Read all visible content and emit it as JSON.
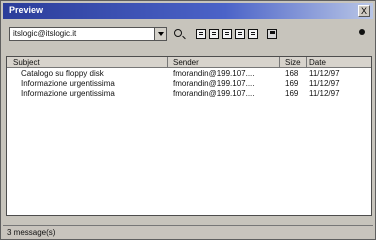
{
  "window": {
    "title": "Preview",
    "close_label": "X"
  },
  "toolbar": {
    "account": "itslogic@itslogic.it"
  },
  "list": {
    "columns": [
      "Subject",
      "Sender",
      "Size",
      "Date"
    ],
    "rows": [
      {
        "subject": "Catalogo su floppy disk",
        "sender": "fmorandin@199.107....",
        "size": "168",
        "date": "11/12/97"
      },
      {
        "subject": "Informazione urgentissima",
        "sender": "fmorandin@199.107....",
        "size": "169",
        "date": "11/12/97"
      },
      {
        "subject": "Informazione urgentissima",
        "sender": "fmorandin@199.107....",
        "size": "169",
        "date": "11/12/97"
      }
    ]
  },
  "status": {
    "text": "3 message(s)"
  }
}
